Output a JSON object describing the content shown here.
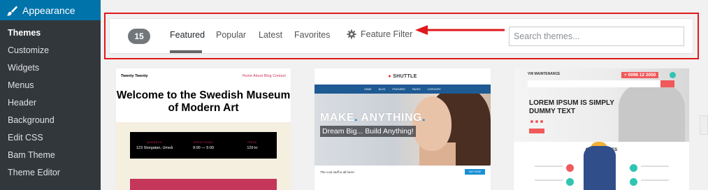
{
  "sidebar": {
    "menu_label": "Appearance",
    "items": [
      {
        "label": "Themes"
      },
      {
        "label": "Customize"
      },
      {
        "label": "Widgets"
      },
      {
        "label": "Menus"
      },
      {
        "label": "Header"
      },
      {
        "label": "Background"
      },
      {
        "label": "Edit CSS"
      },
      {
        "label": "Bam Theme"
      },
      {
        "label": "Theme Editor"
      }
    ]
  },
  "filter_bar": {
    "count": "15",
    "tabs": [
      {
        "label": "Featured"
      },
      {
        "label": "Popular"
      },
      {
        "label": "Latest"
      },
      {
        "label": "Favorites"
      }
    ],
    "feature_filter_label": "Feature Filter",
    "search_placeholder": "Search themes..."
  },
  "colors": {
    "sidebar_bg": "#23282d",
    "submenu_bg": "#32373c",
    "accent": "#0073aa",
    "annotation_red": "#e0181c",
    "page_bg": "#f1f1f1"
  },
  "themes": [
    {
      "name": "Twenty Twenty",
      "nav_brand": "Twenty Twenty",
      "nav_menu": "Home  About  Blog  Contact",
      "headline": "Welcome to the Swedish Museum of Modern Art",
      "info": [
        {
          "key": "ADDRESS",
          "value": "123 Storgatan, Umeå"
        },
        {
          "key": "OPEN TODAY",
          "value": "9:00 — 5:00"
        },
        {
          "key": "PRICE",
          "value": "129 kr"
        }
      ]
    },
    {
      "name": "Shuttle",
      "logo": "SHUTTLE",
      "nav": [
        "HOME",
        "BLOG",
        "FEATURES",
        "PAGES",
        "CATEGORY"
      ],
      "hero_line1_a": "MAKE",
      "hero_line1_b": "ANYTHING",
      "hero_line2": "Dream Big... Build Anything!",
      "cta_text": "The cool stuff is all here!",
      "button": "BUY NOW"
    },
    {
      "name": "VW Maintenance",
      "logo": "VW MAINTENANCE",
      "phone": "+ 0096 12 2050",
      "headline_1": "LOREM IPSUM IS SIMPLY",
      "headline_2": "DUMMY TEXT",
      "services_title": "OUR SERVICES"
    }
  ]
}
